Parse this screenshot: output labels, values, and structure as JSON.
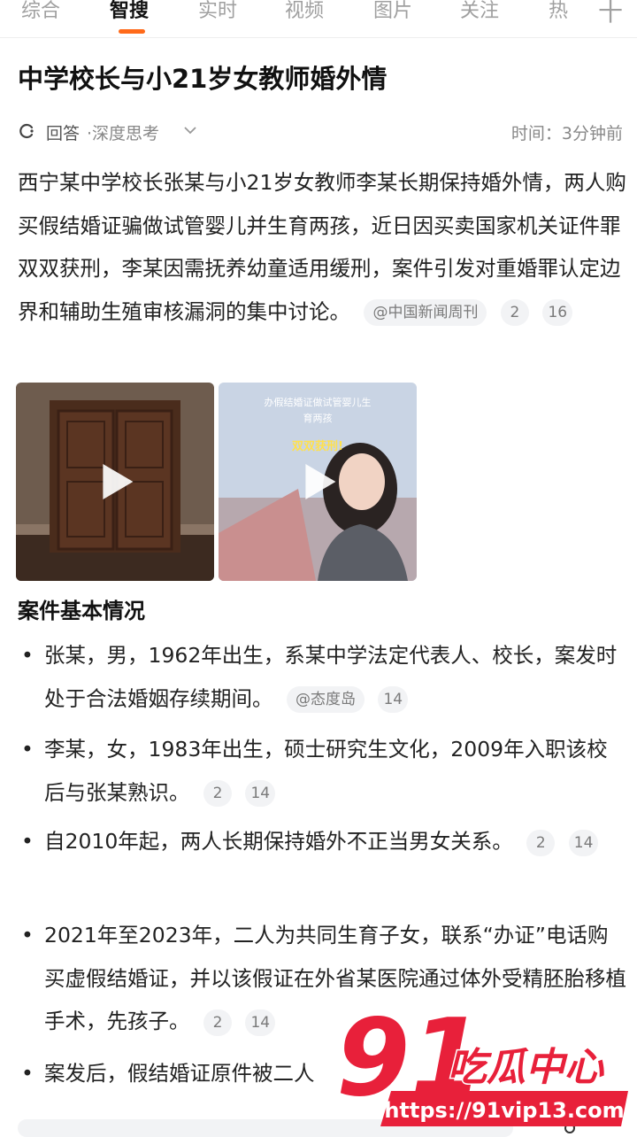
{
  "tabs": [
    {
      "label": "综合"
    },
    {
      "label": "智搜"
    },
    {
      "label": "实时"
    },
    {
      "label": "视频"
    },
    {
      "label": "图片"
    },
    {
      "label": "关注"
    },
    {
      "label": "热"
    }
  ],
  "tab_more_label": "十",
  "title": "中学校长与小21岁女教师婚外情",
  "meta": {
    "label": "回答",
    "mode": "·深度思考",
    "time": "时间：3分钟前"
  },
  "summary": {
    "text": "西宁某中学校长张某与小21岁女教师李某长期保持婚外情，两人购买假结婚证骗做试管婴儿并生育两孩，近日因买卖国家机关证件罪双双获刑，李某因需抚养幼童适用缓刑，案件引发对重婚罪认定边界和辅助生殖审核漏洞的集中讨论。",
    "source": "@中国新闻周刊",
    "count1": "2",
    "count2": "16"
  },
  "video2_caption": {
    "line1": "办假结婚证做试管婴儿生",
    "line2": "育两孩",
    "line3": "双双获刑!"
  },
  "section_title": "案件基本情况",
  "bullets": [
    {
      "text": "张某，男，1962年出生，系某中学法定代表人、校长，案发时处于合法婚姻存续期间。",
      "source": "@态度岛",
      "count2": "14"
    },
    {
      "text": "李某，女，1983年出生，硕士研究生文化，2009年入职该校后与张某熟识。",
      "count1": "2",
      "count2": "14"
    },
    {
      "text": "自2010年起，两人长期保持婚外不正当男女关系。",
      "count1": "2",
      "count2": "14"
    },
    {
      "text": "2021年至2023年，二人为共同生育子女，联系“办证”电话购买虚假结婚证，并以该假证在外省某医院通过体外受精胚胎移植手术，先",
      "tail": "孩子。",
      "count1": "2",
      "count2": "14"
    },
    {
      "text": "案发后，假结婚证原件被二人"
    }
  ],
  "watermark": {
    "big": "91",
    "cn": "吃瓜中心",
    "url": "https://91vip13.com"
  },
  "colors": {
    "accent": "#ff6a1a",
    "watermark_red": "#e8203a"
  }
}
